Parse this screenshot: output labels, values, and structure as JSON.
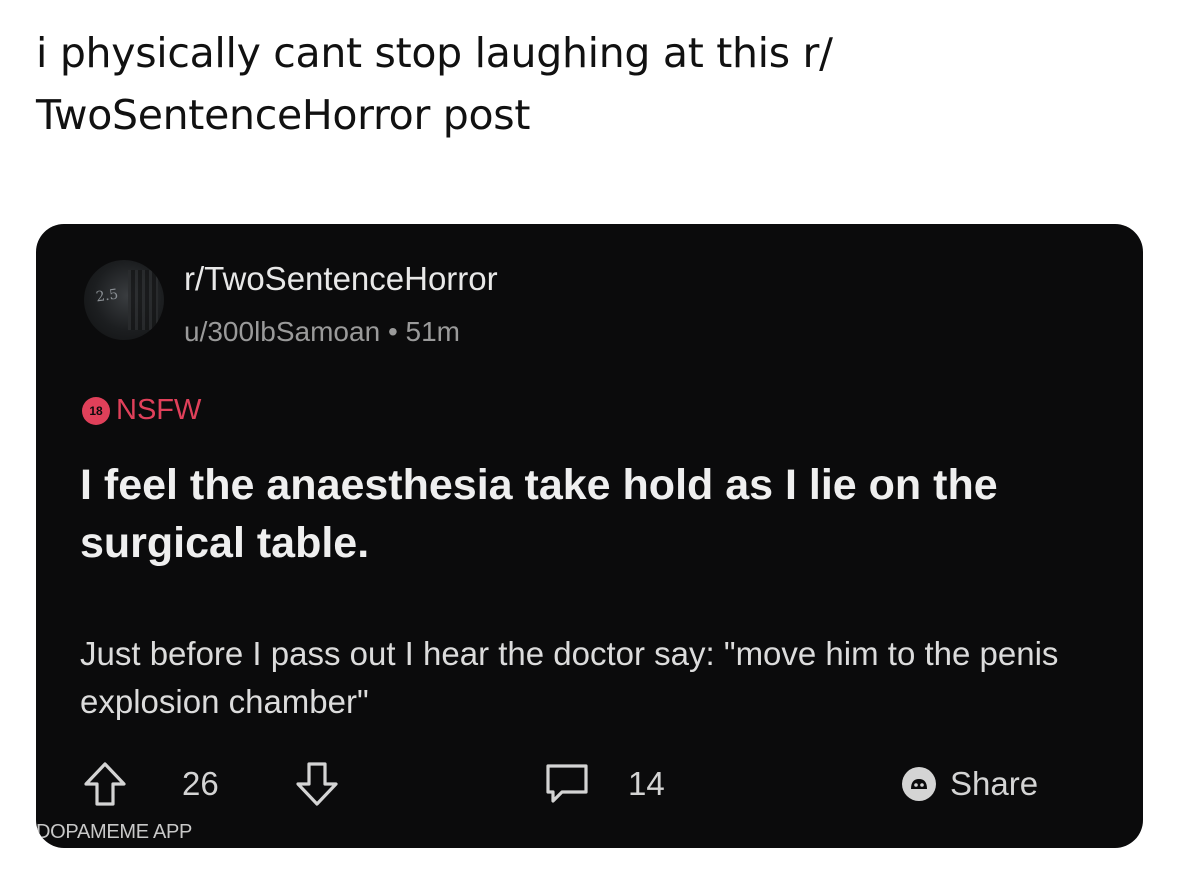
{
  "tweet": {
    "text": "i physically cant stop laughing at this r/ TwoSentenceHorror post"
  },
  "post": {
    "subreddit": "r/TwoSentenceHorror",
    "author": "u/300lbSamoan",
    "separator": "•",
    "time": "51m",
    "avatar_text": "2.5",
    "nsfw_badge": "18",
    "nsfw_label": "NSFW",
    "title": "I feel the anaesthesia take hold as I lie on the surgical table.",
    "body": "Just before I pass out I hear the doctor say: \"move him to the penis explosion chamber\"",
    "upvotes": "26",
    "comments": "14",
    "share_label": "Share"
  },
  "watermark": "DOPAMEME APP",
  "icons": {
    "upvote": "arrow-up-icon",
    "downvote": "arrow-down-icon",
    "comment": "comment-bubble-icon",
    "share": "share-icon"
  },
  "colors": {
    "card_bg": "#0b0b0c",
    "nsfw": "#e0405a",
    "text_primary": "#efefef",
    "text_secondary": "#9a9a9a"
  }
}
